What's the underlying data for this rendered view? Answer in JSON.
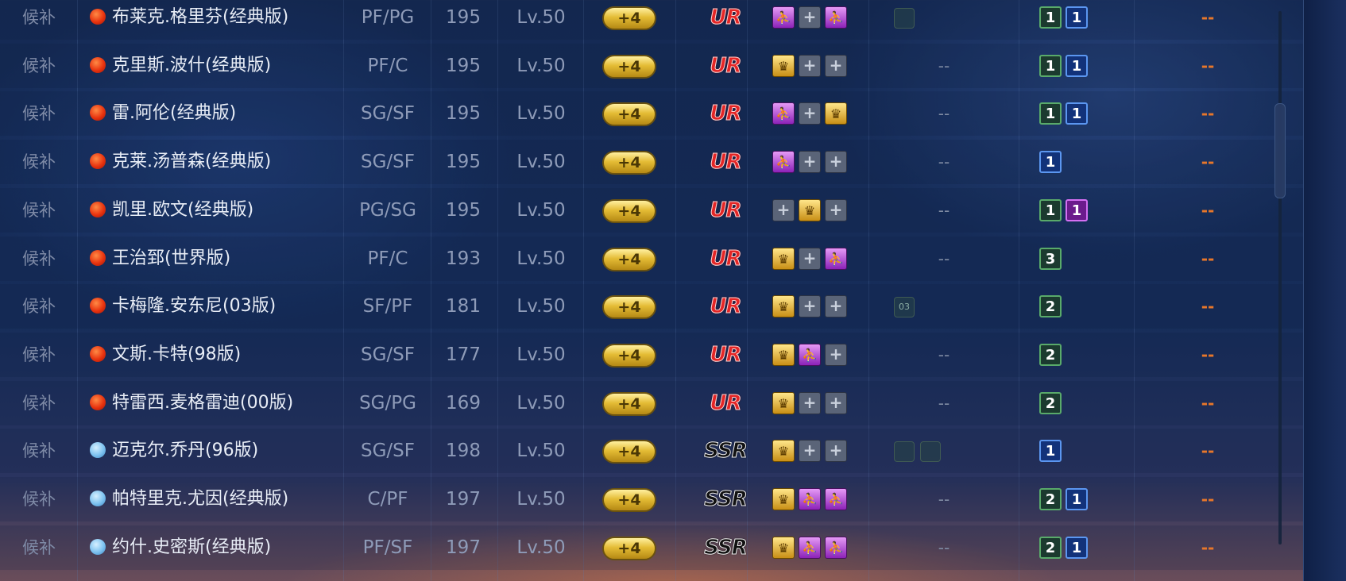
{
  "rows": [
    {
      "status": "候补",
      "name": "布莱克.格里芬(经典版)",
      "position": "PF/PG",
      "overall": "195",
      "level": "Lv.50",
      "bonus": "+4",
      "rarity": "UR",
      "dot": "red",
      "slots": [
        "purple",
        "empty",
        "purple"
      ],
      "badges": [
        "badge"
      ],
      "badge_dash": "",
      "chips": [
        {
          "value": "1",
          "color": "green"
        },
        {
          "value": "1",
          "color": "blue"
        }
      ],
      "tail": "--"
    },
    {
      "status": "候补",
      "name": "克里斯.波什(经典版)",
      "position": "PF/C",
      "overall": "195",
      "level": "Lv.50",
      "bonus": "+4",
      "rarity": "UR",
      "dot": "red",
      "slots": [
        "gold",
        "empty",
        "empty"
      ],
      "badges": [],
      "badge_dash": "--",
      "chips": [
        {
          "value": "1",
          "color": "green"
        },
        {
          "value": "1",
          "color": "blue"
        }
      ],
      "tail": "--"
    },
    {
      "status": "候补",
      "name": "雷.阿伦(经典版)",
      "position": "SG/SF",
      "overall": "195",
      "level": "Lv.50",
      "bonus": "+4",
      "rarity": "UR",
      "dot": "red",
      "slots": [
        "purple",
        "empty",
        "gold"
      ],
      "badges": [],
      "badge_dash": "--",
      "chips": [
        {
          "value": "1",
          "color": "green"
        },
        {
          "value": "1",
          "color": "blue"
        }
      ],
      "tail": "--"
    },
    {
      "status": "候补",
      "name": "克莱.汤普森(经典版)",
      "position": "SG/SF",
      "overall": "195",
      "level": "Lv.50",
      "bonus": "+4",
      "rarity": "UR",
      "dot": "red",
      "slots": [
        "purple",
        "empty",
        "empty"
      ],
      "badges": [],
      "badge_dash": "--",
      "chips": [
        {
          "value": "1",
          "color": "blue"
        }
      ],
      "tail": "--"
    },
    {
      "status": "候补",
      "name": "凯里.欧文(经典版)",
      "position": "PG/SG",
      "overall": "195",
      "level": "Lv.50",
      "bonus": "+4",
      "rarity": "UR",
      "dot": "red",
      "slots": [
        "empty",
        "gold",
        "empty"
      ],
      "badges": [],
      "badge_dash": "--",
      "chips": [
        {
          "value": "1",
          "color": "green"
        },
        {
          "value": "1",
          "color": "purple"
        }
      ],
      "tail": "--"
    },
    {
      "status": "候补",
      "name": "王治郅(世界版)",
      "position": "PF/C",
      "overall": "193",
      "level": "Lv.50",
      "bonus": "+4",
      "rarity": "UR",
      "dot": "red",
      "slots": [
        "gold",
        "empty",
        "purple"
      ],
      "badges": [],
      "badge_dash": "--",
      "chips": [
        {
          "value": "3",
          "color": "green"
        }
      ],
      "tail": "--"
    },
    {
      "status": "候补",
      "name": "卡梅隆.安东尼(03版)",
      "position": "SF/PF",
      "overall": "181",
      "level": "Lv.50",
      "bonus": "+4",
      "rarity": "UR",
      "dot": "red",
      "slots": [
        "gold",
        "empty",
        "empty"
      ],
      "badges": [
        "03"
      ],
      "badge_dash": "",
      "chips": [
        {
          "value": "2",
          "color": "green"
        }
      ],
      "tail": "--"
    },
    {
      "status": "候补",
      "name": "文斯.卡特(98版)",
      "position": "SG/SF",
      "overall": "177",
      "level": "Lv.50",
      "bonus": "+4",
      "rarity": "UR",
      "dot": "red",
      "slots": [
        "gold",
        "purple",
        "empty"
      ],
      "badges": [],
      "badge_dash": "--",
      "chips": [
        {
          "value": "2",
          "color": "green"
        }
      ],
      "tail": "--"
    },
    {
      "status": "候补",
      "name": "特雷西.麦格雷迪(00版)",
      "position": "SG/PG",
      "overall": "169",
      "level": "Lv.50",
      "bonus": "+4",
      "rarity": "UR",
      "dot": "red",
      "slots": [
        "gold",
        "empty",
        "empty"
      ],
      "badges": [],
      "badge_dash": "--",
      "chips": [
        {
          "value": "2",
          "color": "green"
        }
      ],
      "tail": "--"
    },
    {
      "status": "候补",
      "name": "迈克尔.乔丹(96版)",
      "position": "SG/SF",
      "overall": "198",
      "level": "Lv.50",
      "bonus": "+4",
      "rarity": "SSR",
      "dot": "blue",
      "slots": [
        "gold",
        "empty",
        "empty"
      ],
      "badges": [
        "badge",
        "badge"
      ],
      "badge_dash": "",
      "chips": [
        {
          "value": "1",
          "color": "blue"
        }
      ],
      "tail": "--"
    },
    {
      "status": "候补",
      "name": "帕特里克.尤因(经典版)",
      "position": "C/PF",
      "overall": "197",
      "level": "Lv.50",
      "bonus": "+4",
      "rarity": "SSR",
      "dot": "blue",
      "slots": [
        "gold",
        "purple",
        "purple"
      ],
      "badges": [],
      "badge_dash": "--",
      "chips": [
        {
          "value": "2",
          "color": "green"
        },
        {
          "value": "1",
          "color": "blue"
        }
      ],
      "tail": "--"
    },
    {
      "status": "候补",
      "name": "约什.史密斯(经典版)",
      "position": "PF/SF",
      "overall": "197",
      "level": "Lv.50",
      "bonus": "+4",
      "rarity": "SSR",
      "dot": "blue",
      "slots": [
        "gold",
        "purple",
        "purple"
      ],
      "badges": [],
      "badge_dash": "--",
      "chips": [
        {
          "value": "2",
          "color": "green"
        },
        {
          "value": "1",
          "color": "blue"
        }
      ],
      "tail": "--"
    }
  ],
  "icons": {
    "gold_slot": "crown-icon",
    "purple_slot": "player-icon",
    "empty_slot": "plus-icon"
  }
}
